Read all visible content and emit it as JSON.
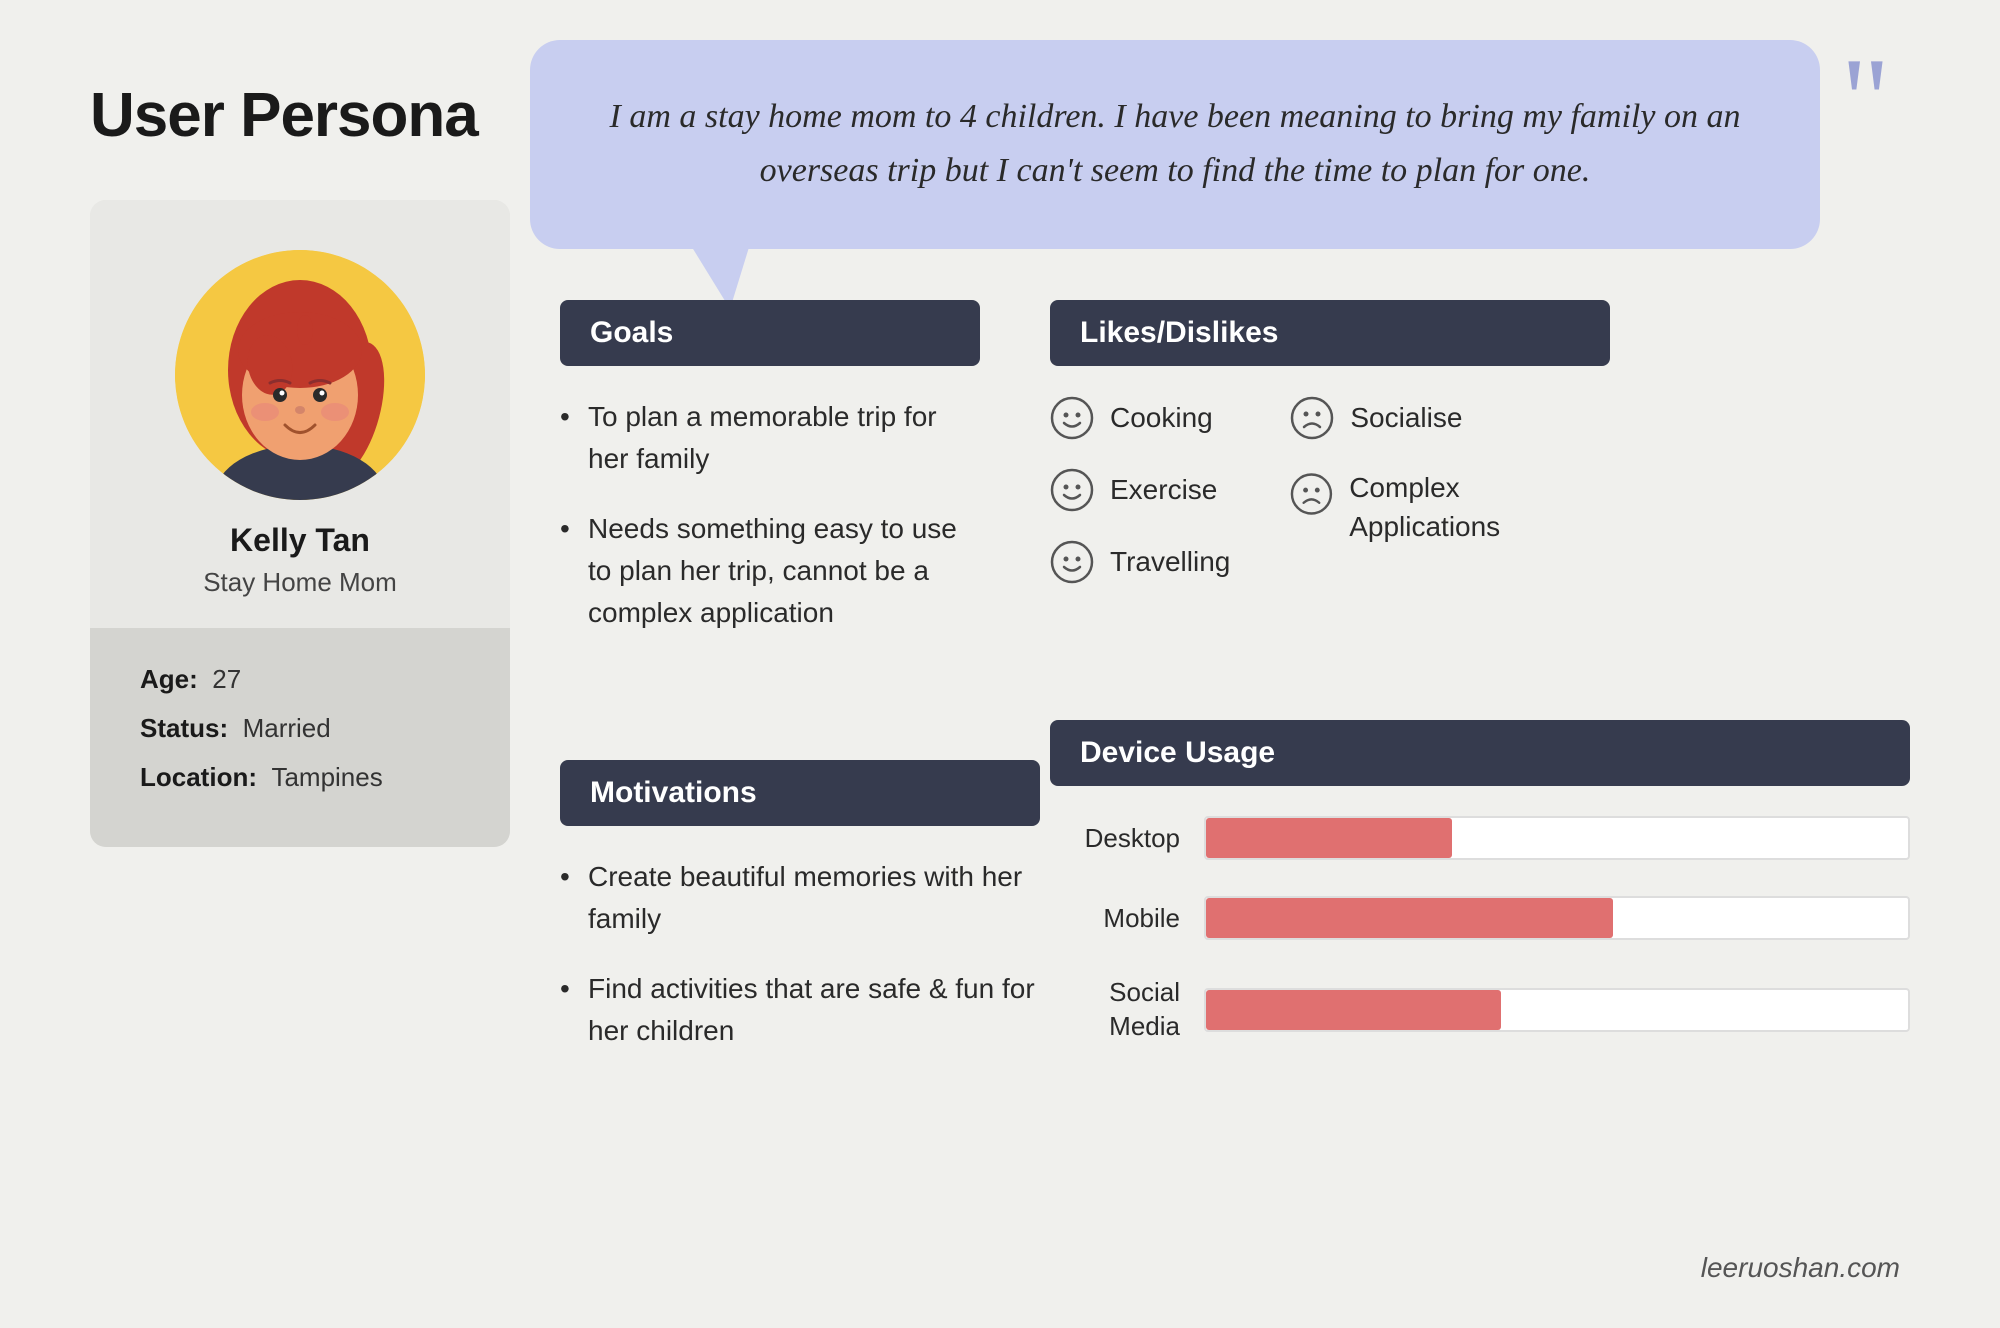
{
  "title": "User Persona",
  "quote": "I am a stay home mom to 4 children. I have been meaning to bring my family on an overseas trip but I can't seem to find the time to plan for one.",
  "persona": {
    "name": "Kelly Tan",
    "role": "Stay Home Mom",
    "age_label": "Age:",
    "age_value": "27",
    "status_label": "Status:",
    "status_value": "Married",
    "location_label": "Location:",
    "location_value": "Tampines"
  },
  "goals": {
    "header": "Goals",
    "items": [
      "To plan a memorable trip for her family",
      "Needs something easy to use to plan her trip, cannot be a complex application"
    ]
  },
  "motivations": {
    "header": "Motivations",
    "items": [
      "Create beautiful memories with her family",
      "Find activities that are safe & fun for her children"
    ]
  },
  "likes_dislikes": {
    "header": "Likes/Dislikes",
    "likes": [
      {
        "label": "Cooking",
        "type": "happy"
      },
      {
        "label": "Exercise",
        "type": "happy"
      },
      {
        "label": "Travelling",
        "type": "happy"
      }
    ],
    "dislikes": [
      {
        "label": "Socialise",
        "type": "sad"
      },
      {
        "label": "Complex Applications",
        "type": "sad"
      }
    ]
  },
  "device_usage": {
    "header": "Device Usage",
    "items": [
      {
        "label": "Desktop",
        "percent": 35
      },
      {
        "label": "Mobile",
        "percent": 55
      },
      {
        "label": "Social Media",
        "percent": 40
      }
    ]
  },
  "footer": "leeruoshan.com"
}
